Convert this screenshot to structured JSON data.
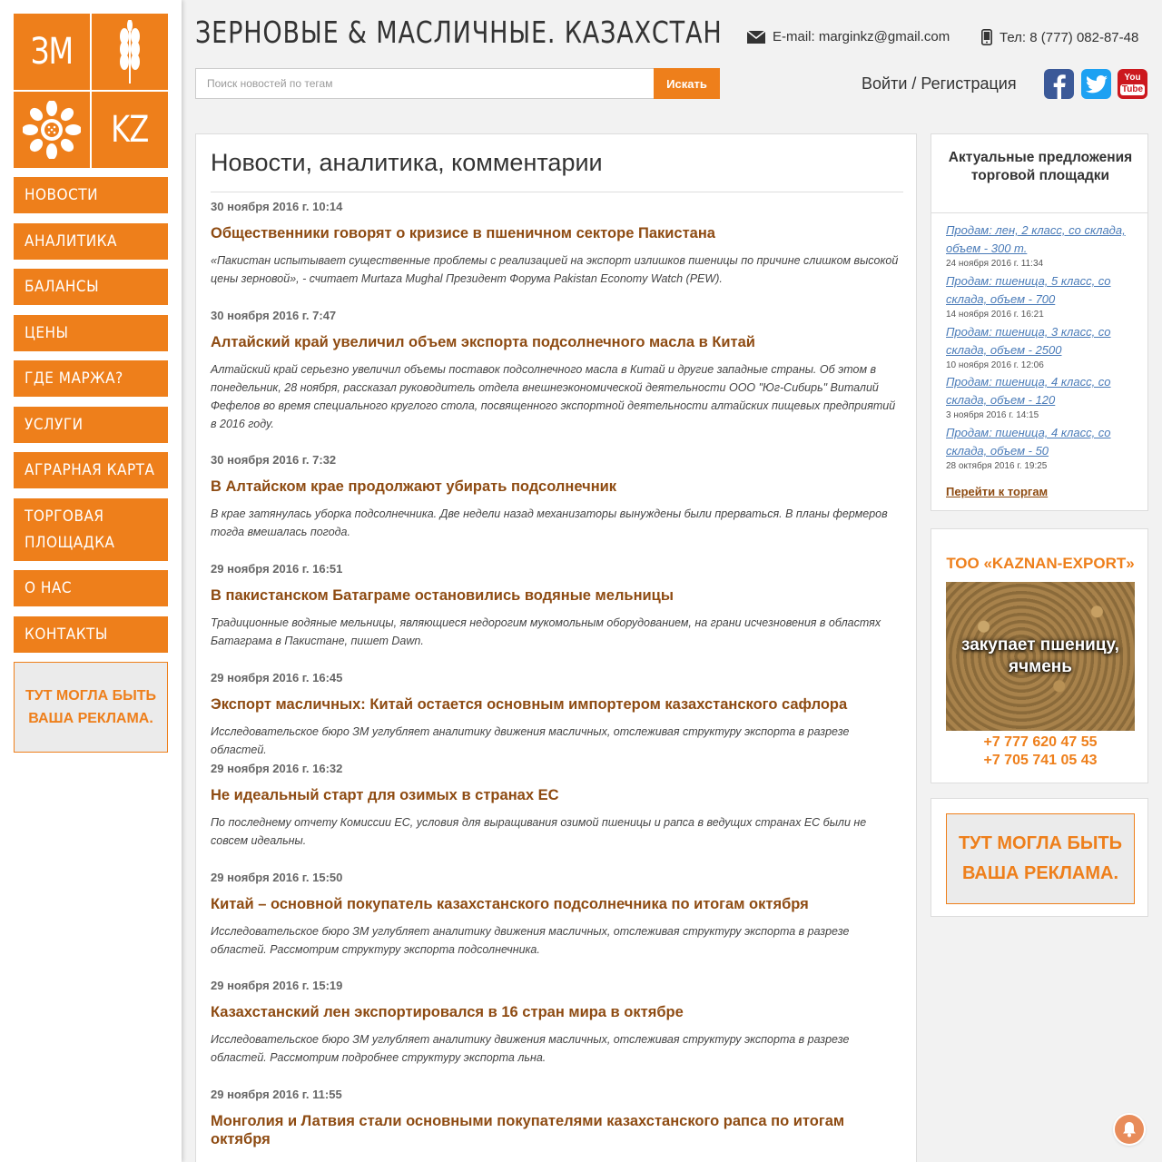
{
  "header": {
    "title": "ЗЕРНОВЫЕ & МАСЛИЧНЫЕ. КАЗАХСТАН",
    "email": "E-mail: marginkz@gmail.com",
    "phone": "Тел: 8 (777) 082-87-48",
    "search_placeholder": "Поиск новостей по тегам",
    "search_button": "Искать",
    "login": "Войти / Регистрация",
    "social": [
      "facebook",
      "twitter",
      "youtube"
    ]
  },
  "logo": {
    "top_left": "ЗМ",
    "bottom_right": "KZ"
  },
  "nav": [
    "НОВОСТИ",
    "АНАЛИТИКА",
    "БАЛАНСЫ",
    "ЦЕНЫ",
    "ГДЕ МАРЖА?",
    "УСЛУГИ",
    "АГРАРНАЯ КАРТА",
    "ТОРГОВАЯ ПЛОЩАДКА",
    "О НАС",
    "КОНТАКТЫ"
  ],
  "ad_text": "ТУТ МОГЛА БЫТЬ ВАША РЕКЛАМА.",
  "main": {
    "title": "Новости, аналитика, комментарии",
    "articles": [
      {
        "date": "30 ноября 2016 г. 10:14",
        "title": "Общественники говорят о кризисе в пшеничном секторе Пакистана",
        "summary": "«Пакистан испытывает существенные проблемы с реализацией на экспорт излишков пшеницы по причине слишком высокой цены зерновой», - считает Murtaza Mughal Президент Форума Pakistan Economy Watch (PEW)."
      },
      {
        "date": "30 ноября 2016 г. 7:47",
        "title": "Алтайский край увеличил объем экспорта подсолнечного масла в Китай",
        "summary": "Алтайский край серьезно увеличил объемы поставок подсолнечного масла в Китай и другие западные страны. Об этом в понедельник, 28 ноября, рассказал руководитель отдела внешнеэкономической деятельности ООО \"Юг-Сибирь\" Виталий Фефелов во время специального круглого стола, посвященного экспортной деятельности алтайских пищевых предприятий в 2016 году."
      },
      {
        "date": "30 ноября 2016 г. 7:32",
        "title": "В Алтайском крае продолжают убирать подсолнечник",
        "summary": "В крае затянулась уборка подсолнечника. Две недели назад механизаторы вынуждены были прерваться. В планы фермеров тогда вмешалась погода."
      },
      {
        "date": "29 ноября 2016 г. 16:51",
        "title": "В пакистанском Батаграме остановились водяные мельницы",
        "summary": "Традиционные водяные мельницы, являющиеся недорогим мукомольным оборудованием, на грани исчезновения в областях Батаграма в Пакистане, пишет Dawn."
      },
      {
        "date": "29 ноября 2016 г. 16:45",
        "title": "Экспорт масличных: Китай остается основным импортером казахстанского сафлора",
        "summary": "Исследовательское бюро ЗМ углубляет аналитику движения масличных, отслеживая структуру экспорта в разрезе областей."
      },
      {
        "date": "29 ноября 2016 г. 16:32",
        "title": "Не идеальный старт для озимых в странах ЕС",
        "summary": "По последнему отчету Комиссии ЕС, условия для выращивания озимой пшеницы и рапса в ведущих странах ЕС были не совсем идеальны."
      },
      {
        "date": "29 ноября 2016 г. 15:50",
        "title": "Китай – основной покупатель казахстанского подсолнечника по итогам октября",
        "summary": "Исследовательское бюро ЗМ углубляет аналитику движения масличных, отслеживая структуру экспорта в разрезе областей. Рассмотрим структуру экспорта подсолнечника."
      },
      {
        "date": "29 ноября 2016 г. 15:19",
        "title": "Казахстанский лен экспортировался в 16 стран мира в октябре",
        "summary": "Исследовательское бюро ЗМ углубляет аналитику движения масличных, отслеживая структуру экспорта в разрезе областей. Рассмотрим подробнее структуру экспорта льна."
      },
      {
        "date": "29 ноября 2016 г. 11:55",
        "title": "Монголия и Латвия стали основными покупателями казахстанского рапса по итогам октября",
        "summary": ""
      }
    ]
  },
  "trade": {
    "title": "Актуальные предложения торговой площадки",
    "offers": [
      {
        "title": "Продам: лен, 2 класс, со склада, объем - 300 т.",
        "date": "24 ноября 2016 г. 11:34"
      },
      {
        "title": "Продам: пшеница, 5 класс, со склада, объем - 700",
        "date": "14 ноября 2016 г. 16:21"
      },
      {
        "title": "Продам: пшеница, 3 класс, со склада, объем - 2500",
        "date": "10 ноября 2016 г. 12:06"
      },
      {
        "title": "Продам: пшеница, 4 класс, со склада, объем - 120",
        "date": "3 ноября 2016 г. 14:15"
      },
      {
        "title": "Продам: пшеница, 4 класс, со склада, объем - 50",
        "date": "28 октября 2016 г. 19:25"
      }
    ],
    "link": "Перейти к торгам"
  },
  "kaznan": {
    "title": "ТОО «KAZNAN-EXPORT»",
    "image_text": "закупает пшеницу, ячмень",
    "phones": [
      "+7 777 620 47 55",
      "+7 705 741 05 43"
    ]
  },
  "colors": {
    "accent": "#ee7f1b",
    "title_brown": "#8e4b12",
    "link_blue": "#4a7bb8"
  }
}
